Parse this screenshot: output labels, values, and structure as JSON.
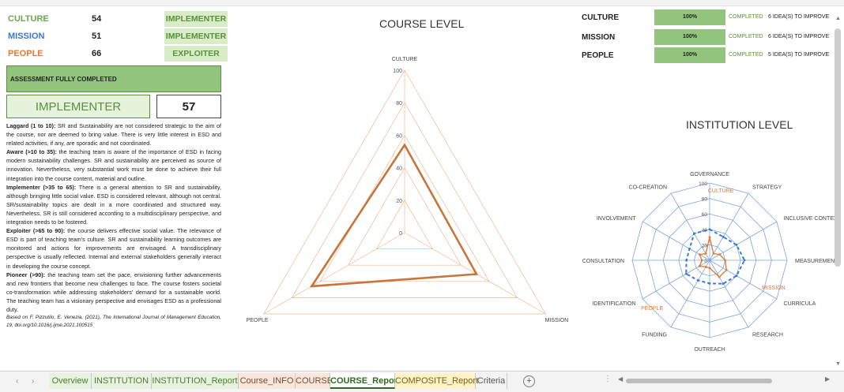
{
  "left": {
    "scores": [
      {
        "label": "CULTURE",
        "value": "54",
        "level": "IMPLEMENTER",
        "color": "#6aa84f"
      },
      {
        "label": "MISSION",
        "value": "51",
        "level": "IMPLEMENTER",
        "color": "#3c78d8"
      },
      {
        "label": "PEOPLE",
        "value": "66",
        "level": "EXPLOITER",
        "color": "#e07b39"
      }
    ],
    "assessment": "ASSESSMENT FULLY COMPLETED",
    "overall_level": "IMPLEMENTER",
    "overall_score": "57",
    "levels": [
      {
        "name": "Laggard (1 to 10):",
        "text": " SR and Sustainability are not considered strategic to the aim of the course, nor are deemed to bring value. There is very little interest in ESD and related activities, if any, are sporadic and not coordinated."
      },
      {
        "name": "Aware (>10 to 35):",
        "text": " the teaching team is aware of the importance of ESD in facing modern sustainability challenges. SR and sustainability are perceived as source of innovation. Nevertheless, very substantial work must be done to achieve their full integration into the course content, material and outline."
      },
      {
        "name": "Implementer (>35 to 65):",
        "text": " There is a general attention to SR and sustainability, although bringing little social value. ESD is considered relevant, although not central. SR/sustainability topics are dealt in a more coordinated and structured way. Nevertheless, SR is still considered according to a multidisciplinary perspective, and integration needs to be fostered."
      },
      {
        "name": "Exploiter (>65 to 90):",
        "text": " the course delivers effective social value. The relevance of ESD is part of teaching team's culture. SR and sustainability learning outcomes are monitored and actions for improvements are envisaged. A transdisciplinary perspective is usually reflected. Internal and external stakeholders generally interact in developing the course concept."
      },
      {
        "name": "Pioneer (>90):",
        "text": " the teaching team set the pace, envisioning further advancements and new frontiers that become new challenges to face. The course fosters societal co-transformation while addressing stakeholders' demand for a sustainable world. The teaching team has a visionary perspective and envisages ESD as a professional duty."
      }
    ],
    "reference": "Based on F. Pizzutilo, E. Venezia, (2021), The International Journal of Management Education, 19, doi.org/10.1016/j.ijme.2021.100515"
  },
  "course_chart": {
    "title": "COURSE LEVEL",
    "axis_labels": [
      "CULTURE",
      "MISSION",
      "PEOPLE"
    ],
    "ticks": [
      "0",
      "20",
      "40",
      "60",
      "80",
      "100"
    ]
  },
  "institution_chart": {
    "title": "INSTITUTION LEVEL",
    "axis_labels": [
      "GOVERNANCE",
      "STRATEGY",
      "INCLUSIVE CONTEXT",
      "MEASUREMENT",
      "CURRICULA",
      "RESEARCH",
      "OUTREACH",
      "FUNDING",
      "IDENTIFICATION",
      "CONSULTATION",
      "INVOLVEMENT",
      "CO-CREATION"
    ],
    "ticks": [
      "0",
      "20",
      "40",
      "60",
      "80",
      "100"
    ],
    "group_labels": [
      "CULTURE",
      "MISSION",
      "PEOPLE"
    ]
  },
  "status_rows": [
    {
      "label": "CULTURE",
      "pct": "100%",
      "status": "COMPLETED",
      "ideas": "6  IDEA(S) TO IMPROVE"
    },
    {
      "label": "MISSION",
      "pct": "100%",
      "status": "COMPLETED",
      "ideas": "6  IDEA(S) TO IMPROVE"
    },
    {
      "label": "PEOPLE",
      "pct": "100%",
      "status": "COMPLETED",
      "ideas": "5  IDEA(S) TO IMPROVE"
    }
  ],
  "tabs": [
    {
      "label": "Overview",
      "style": "green"
    },
    {
      "label": "INSTITUTION",
      "style": "green"
    },
    {
      "label": "INSTITUTION_Report",
      "style": "green"
    },
    {
      "label": "Course_INFO",
      "style": "pink"
    },
    {
      "label": "COURSE",
      "style": "pink"
    },
    {
      "label": "COURSE_Report",
      "style": "active"
    },
    {
      "label": "COMPOSITE_Report",
      "style": "yellow"
    },
    {
      "label": "Criteria",
      "style": "plain"
    }
  ],
  "chart_data": [
    {
      "type": "radar",
      "title": "COURSE LEVEL",
      "categories": [
        "CULTURE",
        "MISSION",
        "PEOPLE"
      ],
      "series": [
        {
          "values": [
            54,
            51,
            66
          ],
          "color": "#c8743a"
        }
      ],
      "rlim": [
        0,
        100
      ],
      "ticks": [
        0,
        20,
        40,
        60,
        80,
        100
      ]
    },
    {
      "type": "radar",
      "title": "INSTITUTION LEVEL",
      "categories": [
        "GOVERNANCE",
        "STRATEGY",
        "INCLUSIVE CONTEXT",
        "MEASUREMENT",
        "CURRICULA",
        "RESEARCH",
        "OUTREACH",
        "FUNDING",
        "IDENTIFICATION",
        "CONSULTATION",
        "INVOLVEMENT",
        "CO-CREATION"
      ],
      "series": [
        {
          "values": [
            30,
            10,
            15,
            20,
            25,
            25,
            10,
            10,
            15,
            10,
            15,
            10
          ],
          "color": "#e07b39"
        },
        {
          "values": [
            40,
            35,
            40,
            45,
            40,
            35,
            30,
            30,
            35,
            30,
            30,
            40
          ],
          "color": "#3c78d8"
        }
      ],
      "rlim": [
        0,
        100
      ],
      "ticks": [
        0,
        20,
        40,
        60,
        80,
        100
      ]
    }
  ]
}
